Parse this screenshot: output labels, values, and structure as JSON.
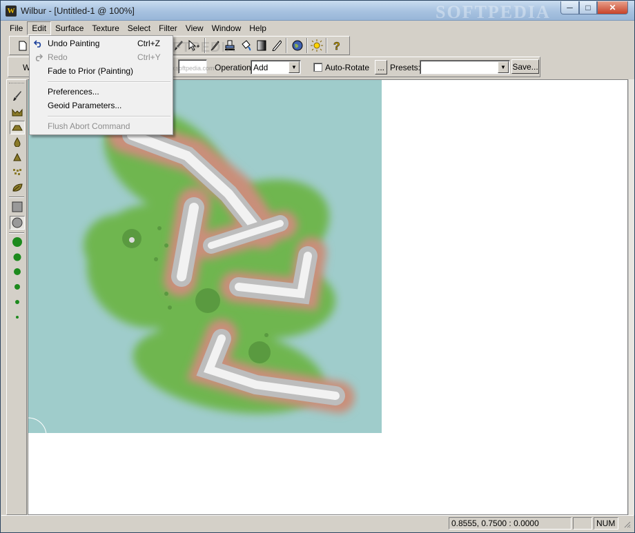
{
  "window": {
    "title": "Wilbur - [Untitled-1 @ 100%]",
    "logo_letter": "W",
    "watermark": "SOFTPEDIA",
    "watermark_url": "www.softpedia.com",
    "controls": {
      "minimize": "─",
      "maximize": "□",
      "close": "✕"
    }
  },
  "menubar": {
    "items": [
      "File",
      "Edit",
      "Surface",
      "Texture",
      "Select",
      "Filter",
      "View",
      "Window",
      "Help"
    ],
    "active": "Edit"
  },
  "edit_menu": {
    "undo": {
      "label": "Undo Painting",
      "shortcut": "Ctrl+Z"
    },
    "redo": {
      "label": "Redo",
      "shortcut": "Ctrl+Y"
    },
    "fade": {
      "label": "Fade to Prior (Painting)"
    },
    "preferences": {
      "label": "Preferences..."
    },
    "geoid": {
      "label": "Geoid Parameters..."
    },
    "flush": {
      "label": "Flush Abort Command"
    }
  },
  "options_bar": {
    "left_label": "W",
    "operation_label": "Operation:",
    "operation_value": "Add",
    "autorotate_label": "Auto-Rotate",
    "autorotate_checked": false,
    "more_button": "...",
    "presets_label": "Presets:",
    "presets_value": "",
    "save_button": "Save..."
  },
  "statusbar": {
    "coords": "0.8555, 0.7500 : 0.0000",
    "empty": "",
    "num": "NUM"
  },
  "colors": {
    "water": "#9fcccb",
    "grass": "#6db54a",
    "rock": "#c98f7a",
    "snow": "#f2f2f2",
    "title_gradient": "#a7c2e0"
  },
  "icons": {
    "toolbar": [
      "new-icon",
      "paint-brush-icon",
      "select-arrow-icon",
      "eyedropper-icon",
      "stamp-icon",
      "bucket-icon",
      "gradient-icon",
      "pencil-icon",
      "globe-icon",
      "sun-icon",
      "help-icon"
    ],
    "left_tools": [
      "brush-icon",
      "valley-icon",
      "plateau-icon",
      "drop-icon",
      "peak-icon",
      "noise-icon",
      "leaf-icon",
      "square-icon",
      "circle-icon",
      "dot-xl-icon",
      "dot-l-icon",
      "dot-m-icon",
      "dot-s-icon",
      "dot-xs-icon",
      "dot-xxs-icon"
    ]
  }
}
